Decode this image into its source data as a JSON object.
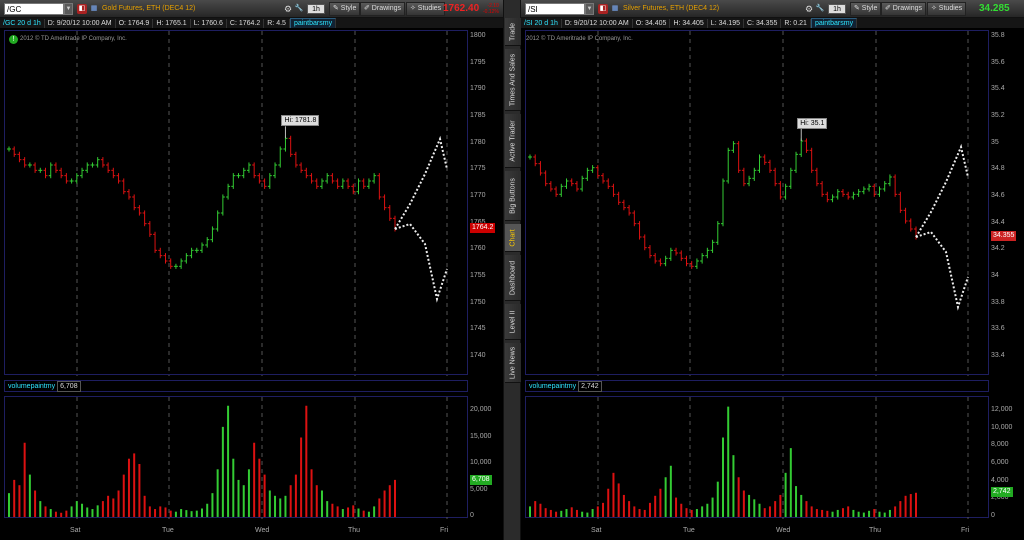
{
  "side_tabs": [
    "Trade",
    "Times And Sales",
    "Active Trader",
    "Big Buttons",
    "Chart",
    "Dashboard",
    "Level II",
    "Live News"
  ],
  "active_tab": "Chart",
  "colors": {
    "up": "#33cc33",
    "down": "#dd1111",
    "last_up": "#33dd33",
    "last_down": "#ee2222",
    "study": "#2ee5ff",
    "desc": "#e6a000"
  },
  "panels": [
    {
      "symbol": "/GC",
      "description": "Gold Futures, ETH (DEC4 12)",
      "aggregation": "1h",
      "buttons": {
        "style": "Style",
        "drawings": "Drawings",
        "studies": "Studies"
      },
      "last": "1762.40",
      "last_direction": "down",
      "change": [
        "-2.10",
        "-0.12%"
      ],
      "ohlc": [
        "/GC 20 d 1h",
        "D: 9/20/12 10:00 AM",
        "O: 1764.9",
        "H: 1765.1",
        "L: 1760.6",
        "C: 1764.2",
        "R: 4.5"
      ],
      "study_tag": "paintbarsmy",
      "copyright": "2012 © TD Ameritrade IP Company, Inc.",
      "hi_label": "Hi: 1781.8",
      "price_badge": "1764.2",
      "price_axis": [
        "1800",
        "1795",
        "1790",
        "1785",
        "1780",
        "1775",
        "1770",
        "1765",
        "1760",
        "1755",
        "1750",
        "1745",
        "1740"
      ],
      "volume_study": "volumepaintmy",
      "volume_value": "6,708",
      "volume_axis": [
        "20,000",
        "15,000",
        "10,000",
        "5,000",
        "0"
      ],
      "days": [
        "Sat",
        "Tue",
        "Wed",
        "Thu",
        "Fri"
      ],
      "close_series": [
        1779,
        1778,
        1777,
        1776,
        1776,
        1775,
        1775,
        1774,
        1776,
        1775,
        1774,
        1773,
        1773,
        1774,
        1775,
        1776,
        1776,
        1777,
        1776,
        1775,
        1774,
        1773,
        1771,
        1770,
        1768,
        1767,
        1765,
        1763,
        1760,
        1759,
        1758,
        1757,
        1757,
        1758,
        1759,
        1760,
        1760,
        1761,
        1762,
        1764,
        1767,
        1770,
        1772,
        1774,
        1774,
        1775,
        1776,
        1774,
        1773,
        1772,
        1774,
        1776,
        1779,
        1781,
        1778,
        1776,
        1775,
        1774,
        1773,
        1772,
        1773,
        1774,
        1773,
        1772,
        1773,
        1772,
        1771,
        1773,
        1772,
        1773,
        1774,
        1770,
        1768,
        1766,
        1764
      ],
      "volume_series": [
        4500,
        7000,
        6000,
        14000,
        8000,
        5000,
        3000,
        2000,
        1500,
        1000,
        800,
        1200,
        2000,
        3000,
        2500,
        1800,
        1500,
        2200,
        3000,
        4000,
        3500,
        5000,
        8000,
        11000,
        12000,
        10000,
        4000,
        2000,
        1500,
        2000,
        1800,
        1200,
        1000,
        1500,
        1300,
        1100,
        1200,
        1600,
        2500,
        4500,
        9000,
        17000,
        21000,
        11000,
        7000,
        6000,
        9000,
        14000,
        11000,
        8000,
        5000,
        4000,
        3500,
        4000,
        6000,
        8000,
        15000,
        21000,
        9000,
        6000,
        5000,
        3000,
        2500,
        2000,
        1500,
        1800,
        2200,
        1600,
        1200,
        1000,
        2000,
        3500,
        5000,
        6000,
        7000
      ]
    },
    {
      "symbol": "/SI",
      "description": "Silver Futures, ETH (DEC4 12)",
      "aggregation": "1h",
      "buttons": {
        "style": "Style",
        "drawings": "Drawings",
        "studies": "Studies"
      },
      "last": "34.285",
      "last_direction": "up",
      "change": [],
      "ohlc": [
        "/SI 20 d 1h",
        "D: 9/20/12 10:00 AM",
        "O: 34.405",
        "H: 34.405",
        "L: 34.195",
        "C: 34.355",
        "R: 0.21"
      ],
      "study_tag": "paintbarsmy",
      "copyright": "2012 © TD Ameritrade IP Company, Inc.",
      "hi_label": "Hi: 35.1",
      "price_badge": "34.355",
      "price_axis": [
        "35.8",
        "35.6",
        "35.4",
        "35.2",
        "35",
        "34.8",
        "34.6",
        "34.4",
        "34.2",
        "34",
        "33.8",
        "33.6",
        "33.4"
      ],
      "volume_study": "volumepaintmy",
      "volume_value": "2,742",
      "volume_axis": [
        "12,000",
        "10,000",
        "8,000",
        "6,000",
        "4,000",
        "2,000",
        "0"
      ],
      "days": [
        "Sat",
        "Tue",
        "Wed",
        "Thu",
        "Fri"
      ],
      "close_series": [
        34.9,
        34.85,
        34.78,
        34.7,
        34.66,
        34.62,
        34.68,
        34.72,
        34.7,
        34.66,
        34.74,
        34.8,
        34.82,
        34.76,
        34.72,
        34.68,
        34.62,
        34.56,
        34.52,
        34.48,
        34.4,
        34.3,
        34.22,
        34.16,
        34.12,
        34.1,
        34.14,
        34.2,
        34.18,
        34.14,
        34.1,
        34.08,
        34.12,
        34.16,
        34.2,
        34.26,
        34.4,
        34.72,
        34.95,
        35.0,
        34.8,
        34.7,
        34.74,
        34.8,
        34.9,
        34.86,
        34.8,
        34.7,
        34.6,
        34.68,
        34.8,
        34.92,
        35.02,
        34.95,
        34.8,
        34.7,
        34.62,
        34.58,
        34.6,
        34.64,
        34.62,
        34.6,
        34.62,
        34.64,
        34.66,
        34.68,
        34.62,
        34.66,
        34.7,
        34.75,
        34.62,
        34.5,
        34.42,
        34.36,
        34.3
      ],
      "volume_series": [
        1200,
        1800,
        1500,
        1000,
        800,
        600,
        700,
        900,
        1100,
        800,
        600,
        500,
        900,
        1200,
        1600,
        3200,
        5000,
        3800,
        2500,
        1800,
        1200,
        900,
        800,
        1600,
        2400,
        3200,
        4500,
        5800,
        2200,
        1500,
        1000,
        800,
        900,
        1200,
        1500,
        2200,
        4000,
        9000,
        12500,
        7000,
        4500,
        3000,
        2500,
        2000,
        1500,
        1000,
        1200,
        1800,
        2500,
        5000,
        7800,
        3500,
        2500,
        1800,
        1200,
        900,
        800,
        700,
        600,
        800,
        1000,
        1200,
        800,
        600,
        500,
        700,
        900,
        600,
        500,
        800,
        1200,
        1800,
        2400,
        2600,
        2742
      ]
    }
  ]
}
